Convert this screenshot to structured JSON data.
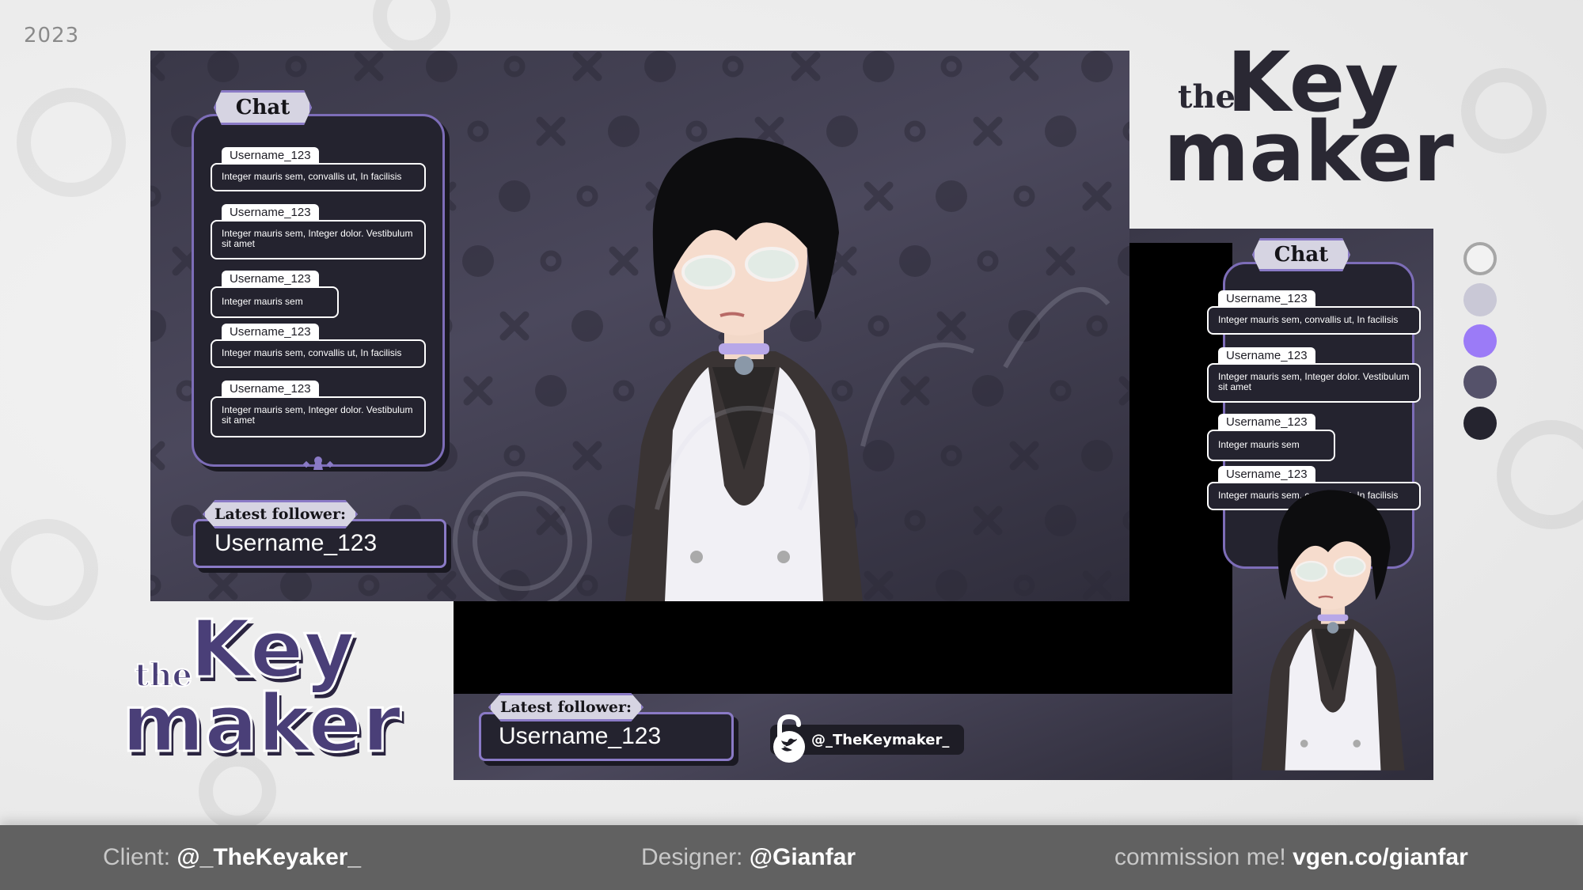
{
  "year": "2023",
  "main_overlay": {
    "chat": {
      "title": "Chat",
      "messages": [
        {
          "username": "Username_123",
          "text": "Integer mauris sem, convallis ut, In facilisis"
        },
        {
          "username": "Username_123",
          "text": "Integer mauris sem, Integer dolor. Vestibulum sit amet"
        },
        {
          "username": "Username_123",
          "text": "Integer mauris sem"
        },
        {
          "username": "Username_123",
          "text": "Integer mauris sem, convallis ut, In facilisis"
        },
        {
          "username": "Username_123",
          "text": "Integer mauris sem, Integer dolor. Vestibulum sit amet"
        }
      ]
    },
    "latest_follower": {
      "label": "Latest follower:",
      "value": "Username_123"
    }
  },
  "logo_top": {
    "the": "the",
    "line1": "Key",
    "line2": "maker"
  },
  "logo_bottom": {
    "the": "the",
    "line1": "Key",
    "line2": "maker"
  },
  "side_overlay": {
    "chat": {
      "title": "Chat",
      "messages": [
        {
          "username": "Username_123",
          "text": "Integer mauris sem, convallis ut, In facilisis"
        },
        {
          "username": "Username_123",
          "text": "Integer mauris sem, Integer dolor. Vestibulum sit amet"
        },
        {
          "username": "Username_123",
          "text": "Integer mauris sem"
        },
        {
          "username": "Username_123",
          "text": "Integer mauris sem, convallis ut, In facilisis"
        }
      ]
    }
  },
  "bottom_overlay": {
    "latest_follower": {
      "label": "Latest follower:",
      "value": "Username_123"
    },
    "social": {
      "icon": "twitter-lock-icon",
      "handle": "@_TheKeymaker_"
    }
  },
  "palette": {
    "colors": [
      "#f2f2f2",
      "#c9c8d6",
      "#9b7bf7",
      "#55526a",
      "#25242f"
    ]
  },
  "footer": {
    "client_label": "Client:",
    "client_value": "@_TheKeyaker_",
    "designer_label": "Designer:",
    "designer_value": "@Gianfar",
    "commission_label": "commission me!",
    "commission_value": "vgen.co/gianfar"
  }
}
